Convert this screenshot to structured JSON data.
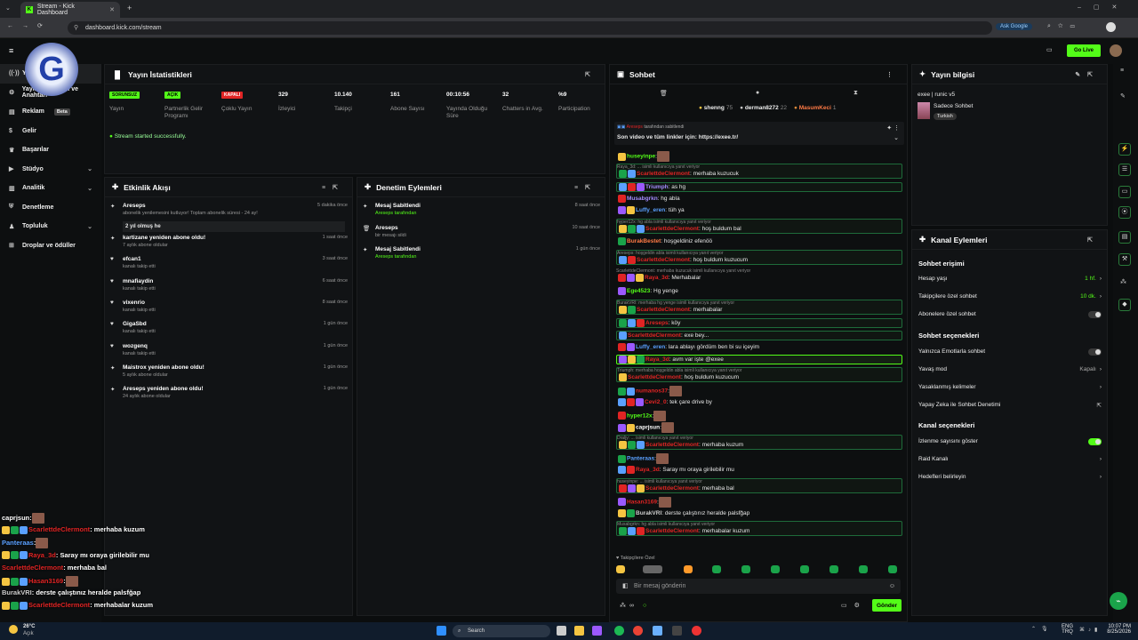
{
  "browser": {
    "tab_title": "Stream - Kick Dashboard",
    "url": "dashboard.kick.com/stream",
    "ask_google": "Ask Google"
  },
  "topbar": {
    "go_live": "Go Live"
  },
  "nav": {
    "items": [
      {
        "label": "Yayın",
        "icon": "broadcast-icon"
      },
      {
        "label": "Yayın Bağlantısı ve Anahtarı",
        "icon": "settings-icon"
      },
      {
        "label": "Reklam",
        "icon": "ad-icon",
        "badge": "Beta"
      },
      {
        "label": "Gelir",
        "icon": "money-icon"
      },
      {
        "label": "Başarılar",
        "icon": "trophy-icon"
      },
      {
        "label": "Stüdyo",
        "icon": "studio-icon"
      },
      {
        "label": "Analitik",
        "icon": "chart-icon"
      },
      {
        "label": "Denetleme",
        "icon": "shield-icon"
      },
      {
        "label": "Topluluk",
        "icon": "users-icon"
      },
      {
        "label": "Droplar ve ödüller",
        "icon": "gift-icon"
      }
    ]
  },
  "stats": {
    "title": "Yayın İstatistikleri",
    "items": [
      {
        "value": "SORUNSUZ",
        "label": "Yayın",
        "badge_color": "#53fc18"
      },
      {
        "value": "AÇIK",
        "label": "Partnerlik Gelir Programı",
        "badge_color": "#53fc18"
      },
      {
        "value": "KAPALI",
        "label": "Çoklu Yayın",
        "badge_color": "#e02424"
      },
      {
        "value": "329",
        "label": "İzleyici"
      },
      {
        "value": "10.140",
        "label": "Takipçi"
      },
      {
        "value": "161",
        "label": "Abone Sayısı"
      },
      {
        "value": "00:10:56",
        "label": "Yayında Olduğu Süre"
      },
      {
        "value": "32",
        "label": "Chatters in Avg."
      },
      {
        "value": "%9",
        "label": "Participation"
      }
    ],
    "status_msg": "Stream started successfully."
  },
  "activity": {
    "title": "Etkinlik Akışı",
    "events": [
      {
        "title": "Areseps",
        "sub": "abonelik yenilemesini kutluyor! Toplam abonelik süresi - 24 ay!",
        "time": "5 dakika önce",
        "msg": "2 yıl olmuş he"
      },
      {
        "title": "kartizane yeniden abone oldu!",
        "sub": "7 aylık abone oldular",
        "time": "1 saat önce"
      },
      {
        "title": "efcan1",
        "sub": "kanalı takip etti",
        "time": "3 saat önce"
      },
      {
        "title": "mnafiaydin",
        "sub": "kanalı takip etti",
        "time": "6 saat önce"
      },
      {
        "title": "vixenrio",
        "sub": "kanalı takip etti",
        "time": "8 saat önce"
      },
      {
        "title": "GigaSbd",
        "sub": "kanalı takip etti",
        "time": "1 gün önce"
      },
      {
        "title": "wozgenq",
        "sub": "kanalı takip etti",
        "time": "1 gün önce"
      },
      {
        "title": "Maistrox yeniden abone oldu!",
        "sub": "5 aylık abone oldular",
        "time": "1 gün önce"
      },
      {
        "title": "Areseps yeniden abone oldu!",
        "sub": "24 aylık abone oldular",
        "time": "1 gün önce"
      }
    ]
  },
  "moderation": {
    "title": "Denetim Eylemleri",
    "events": [
      {
        "title": "Mesaj Sabitlendi",
        "sub": "Areseps tarafından",
        "time": "8 saat önce"
      },
      {
        "title": "Areseps",
        "sub": "bir mesajı sildi",
        "time": "10 saat önce"
      },
      {
        "title": "Mesaj Sabitlendi",
        "sub": "Areseps tarafından",
        "time": "1 gün önce"
      }
    ]
  },
  "chat": {
    "title": "Sohbet",
    "top_users": [
      {
        "name": "shenng",
        "count": "75"
      },
      {
        "name": "derman8272",
        "count": "22"
      },
      {
        "name": "MasumKeci",
        "count": "1"
      }
    ],
    "pinned_by": "tarafından sabitlendi",
    "pinned_text": "Son video ve tüm linkler için: https://exee.tr/",
    "messages": [
      {
        "user": "huseyinpe",
        "color": "#53fc18",
        "text": ":"
      },
      {
        "reply": "Raya_3d: ... isimli kullanıcıya yanıt veriyor",
        "user": "ScarlettdeClermont",
        "color": "#e02424",
        "text": ": merhaba kuzucuk",
        "boxed": true
      },
      {
        "user": "Triumph",
        "color": "#a58cff",
        "text": ": as hg",
        "boxed": true
      },
      {
        "user": "Musabgrkn",
        "color": "#a58cff",
        "text": ": hg abla"
      },
      {
        "user": "Luffy_eren",
        "color": "#5aa0ff",
        "text": ": tüh ya"
      },
      {
        "reply": "hyper12x: hg abla isimli kullanıcıya yanıt veriyor",
        "user": "ScarlettdeClermont",
        "color": "#e02424",
        "text": ": hoş buldum bal",
        "boxed": true
      },
      {
        "user": "BurakBestet",
        "color": "#ff7a45",
        "text": ": hoşgeldiniz efenöö"
      },
      {
        "reply": "Areseps: hoşgeldin abla isimli kullanıcıya yanıt veriyor",
        "user": "ScarlettdeClermont",
        "color": "#e02424",
        "text": ": hoş buldum kuzucum",
        "boxed": true
      },
      {
        "reply": "ScarlettdeClermont: merhaba kuzucuk isimli kullanıcıya yanıt veriyor",
        "user": "Raya_3d",
        "color": "#e02424",
        "text": ": Merhabalar"
      },
      {
        "user": "Ege4523",
        "color": "#53fc18",
        "text": ": Hg yenge"
      },
      {
        "reply": "BurakVRI: merhaba hg yenge isimli kullanıcıya yanıt veriyor",
        "user": "ScarlettdeClermont",
        "color": "#e02424",
        "text": ": merhabalar",
        "boxed": true
      },
      {
        "user": "Areseps",
        "color": "#e02424",
        "text": ": köy",
        "boxed": true
      },
      {
        "user": "ScarlettdeClermont",
        "color": "#e02424",
        "text": ": exe bey...",
        "boxed": true
      },
      {
        "user": "Luffy_eren",
        "color": "#5aa0ff",
        "text": ": lara ablayı gördüm ben bi su içeyim"
      },
      {
        "user": "Raya_3d",
        "color": "#e02424",
        "text": ": avm var işte @exee",
        "boxed": true,
        "highlight": true
      },
      {
        "reply": "Triumph: merhaba hoşgeldin abla isimli kullanıcıya yanıt veriyor",
        "user": "ScarlettdeClermont",
        "color": "#e02424",
        "text": ": hoş buldum kuzucum",
        "boxed": true
      },
      {
        "user": "numanos37",
        "color": "#e02424",
        "text": ":"
      },
      {
        "user": "Cevi2_0",
        "color": "#e02424",
        "text": ": tek çare drive by"
      },
      {
        "user": "hyper12x",
        "color": "#53fc18",
        "text": ":"
      },
      {
        "user": "caprjsun",
        "color": "#ffffff",
        "text": ":"
      },
      {
        "reply": "Draljy: ... isimli kullanıcıya yanıt veriyor",
        "user": "ScarlettdeClermont",
        "color": "#e02424",
        "text": ": merhaba kuzum",
        "boxed": true
      },
      {
        "user": "Panteraas",
        "color": "#5aa0ff",
        "text": ":"
      },
      {
        "user": "Raya_3d",
        "color": "#e02424",
        "text": ": Saray mı oraya girilebilir mu"
      },
      {
        "reply": "huseyinpe: ... isimli kullanıcıya yanıt veriyor",
        "user": "ScarlettdeClermont",
        "color": "#e02424",
        "text": ": merhaba bal",
        "boxed": true
      },
      {
        "user": "Hasan3169",
        "color": "#e02424",
        "text": ":"
      },
      {
        "user": "BurakVRI",
        "color": "#ccc",
        "text": ": derste çalıştınız heralde palsfğap"
      },
      {
        "reply": "Musabgrkn: hg abla isimli kullanıcıya yanıt veriyor",
        "user": "ScarlettdeClermont",
        "color": "#e02424",
        "text": ": merhabalar kuzum",
        "boxed": true
      }
    ],
    "followers_only": "Takipçilere Özel",
    "input_placeholder": "Bir mesaj gönderin",
    "send_label": "Gönder"
  },
  "stream_info": {
    "title": "Yayın bilgisi",
    "stream_title": "exee | runic v5",
    "category": "Sadece Sohbet",
    "tag": "Turkish"
  },
  "channel_actions": {
    "title": "Kanal Eylemleri",
    "chat_access": "Sohbet erişimi",
    "rows_access": [
      {
        "label": "Hesap yaşı",
        "value": "1 hf."
      },
      {
        "label": "Takipçilere özel sohbet",
        "value": "10 dk."
      },
      {
        "label": "Abonelere özel sohbet",
        "toggle": false
      }
    ],
    "chat_options": "Sohbet seçenekleri",
    "rows_options": [
      {
        "label": "Yalnızca Emotlarla sohbet",
        "toggle": false
      },
      {
        "label": "Yavaş mod",
        "value": "Kapalı"
      },
      {
        "label": "Yasaklanmış kelimeler",
        "value": ""
      },
      {
        "label": "Yapay Zeka ile Sohbet Denetimi",
        "value": ""
      }
    ],
    "channel_options": "Kanal seçenekleri",
    "rows_channel": [
      {
        "label": "İzlenme sayısını göster",
        "toggle": true
      },
      {
        "label": "Raid Kanalı",
        "value": ""
      },
      {
        "label": "Hedefleri belirleyin",
        "value": ""
      }
    ]
  },
  "overlay_chat": [
    {
      "user": "caprjsun",
      "color": "#ffffff",
      "text": ":"
    },
    {
      "user": "ScarlettdeClermont",
      "color": "#e02424",
      "text": ": merhaba kuzum"
    },
    {
      "user": "Panteraas",
      "color": "#5aa0ff",
      "text": ":"
    },
    {
      "user": "Raya_3d",
      "color": "#e02424",
      "text": ": Saray mı oraya girilebilir mu"
    },
    {
      "user": "ScarlettdeClermont",
      "color": "#e02424",
      "text": ": merhaba bal"
    },
    {
      "user": "Hasan3169",
      "color": "#e02424",
      "text": ":"
    },
    {
      "user": "BurakVRI",
      "color": "#ccc",
      "text": ": derste çalıştınız heralde palsfğap"
    },
    {
      "user": "ScarlettdeClermont",
      "color": "#e02424",
      "text": ": merhabalar kuzum"
    }
  ],
  "taskbar": {
    "weather_temp": "26°C",
    "weather_desc": "Açık",
    "search": "Search",
    "lang": "ENG",
    "lang2": "TRQ",
    "time": "10:07 PM",
    "date": "8/25/2026"
  }
}
